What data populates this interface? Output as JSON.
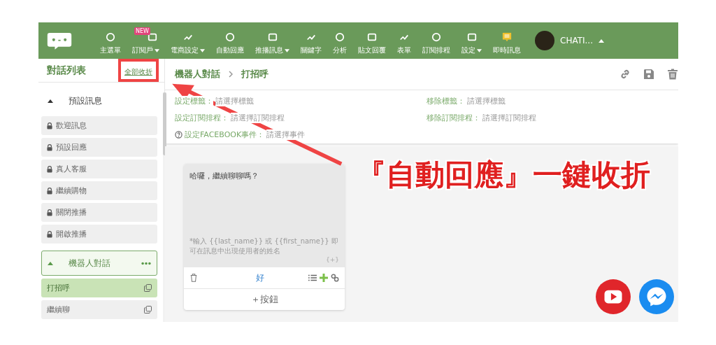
{
  "nav": {
    "items": [
      {
        "label": "主選單",
        "dropdown": false
      },
      {
        "label": "訂閱戶",
        "dropdown": true,
        "badge": "NEW"
      },
      {
        "label": "電商設定",
        "dropdown": true
      },
      {
        "label": "自動回應",
        "dropdown": false
      },
      {
        "label": "推播訊息",
        "dropdown": true
      },
      {
        "label": "關鍵字",
        "dropdown": false
      },
      {
        "label": "分析",
        "dropdown": false
      },
      {
        "label": "貼文回覆",
        "dropdown": false
      },
      {
        "label": "表單",
        "dropdown": false
      },
      {
        "label": "訂閱排程",
        "dropdown": false
      },
      {
        "label": "設定",
        "dropdown": true
      },
      {
        "label": "即時訊息",
        "dropdown": false,
        "live": true
      }
    ],
    "account": "CHATI..."
  },
  "sidebar": {
    "title": "對話列表",
    "collapse_all": "全部收折",
    "groups": [
      {
        "name": "預設訊息",
        "expanded": true,
        "selected": false,
        "more": false,
        "items": [
          {
            "name": "歡迎訊息",
            "locked": true,
            "selected": false
          },
          {
            "name": "預設回應",
            "locked": true,
            "selected": false
          },
          {
            "name": "真人客服",
            "locked": true,
            "selected": false
          },
          {
            "name": "繼續購物",
            "locked": true,
            "selected": false
          },
          {
            "name": "關閉推播",
            "locked": true,
            "selected": false
          },
          {
            "name": "開啟推播",
            "locked": true,
            "selected": false
          }
        ]
      },
      {
        "name": "機器人對話",
        "expanded": true,
        "selected": true,
        "more": true,
        "items": [
          {
            "name": "打招呼",
            "locked": false,
            "selected": true
          },
          {
            "name": "繼續聊",
            "locked": false,
            "selected": false
          }
        ]
      }
    ]
  },
  "main": {
    "breadcrumb": [
      "機器人對話",
      "打招呼"
    ],
    "settings": [
      [
        {
          "label": "設定標籤：",
          "value": "請選擇標籤"
        },
        {
          "label": "移除標籤：",
          "value": "請選擇標籤"
        }
      ],
      [
        {
          "label": "設定訂閱排程：",
          "value": "請選擇訂閱排程"
        },
        {
          "label": "移除訂閱排程：",
          "value": "請選擇訂閱排程"
        }
      ],
      [
        {
          "label": "設定FACEBOOK事件：",
          "value": "請選擇事件",
          "help": true
        }
      ]
    ],
    "card": {
      "message": "哈囉，繼續聊聊嗎？",
      "hint": "*輸入 {{last_name}} 或 {{first_name}} 即可在訊息中出現使用者的姓名",
      "variable_button": "{+}",
      "buttons": [
        "好"
      ],
      "add_button": "＋按鈕"
    }
  },
  "annotation": {
    "text": "『自動回應』一鍵收折"
  }
}
